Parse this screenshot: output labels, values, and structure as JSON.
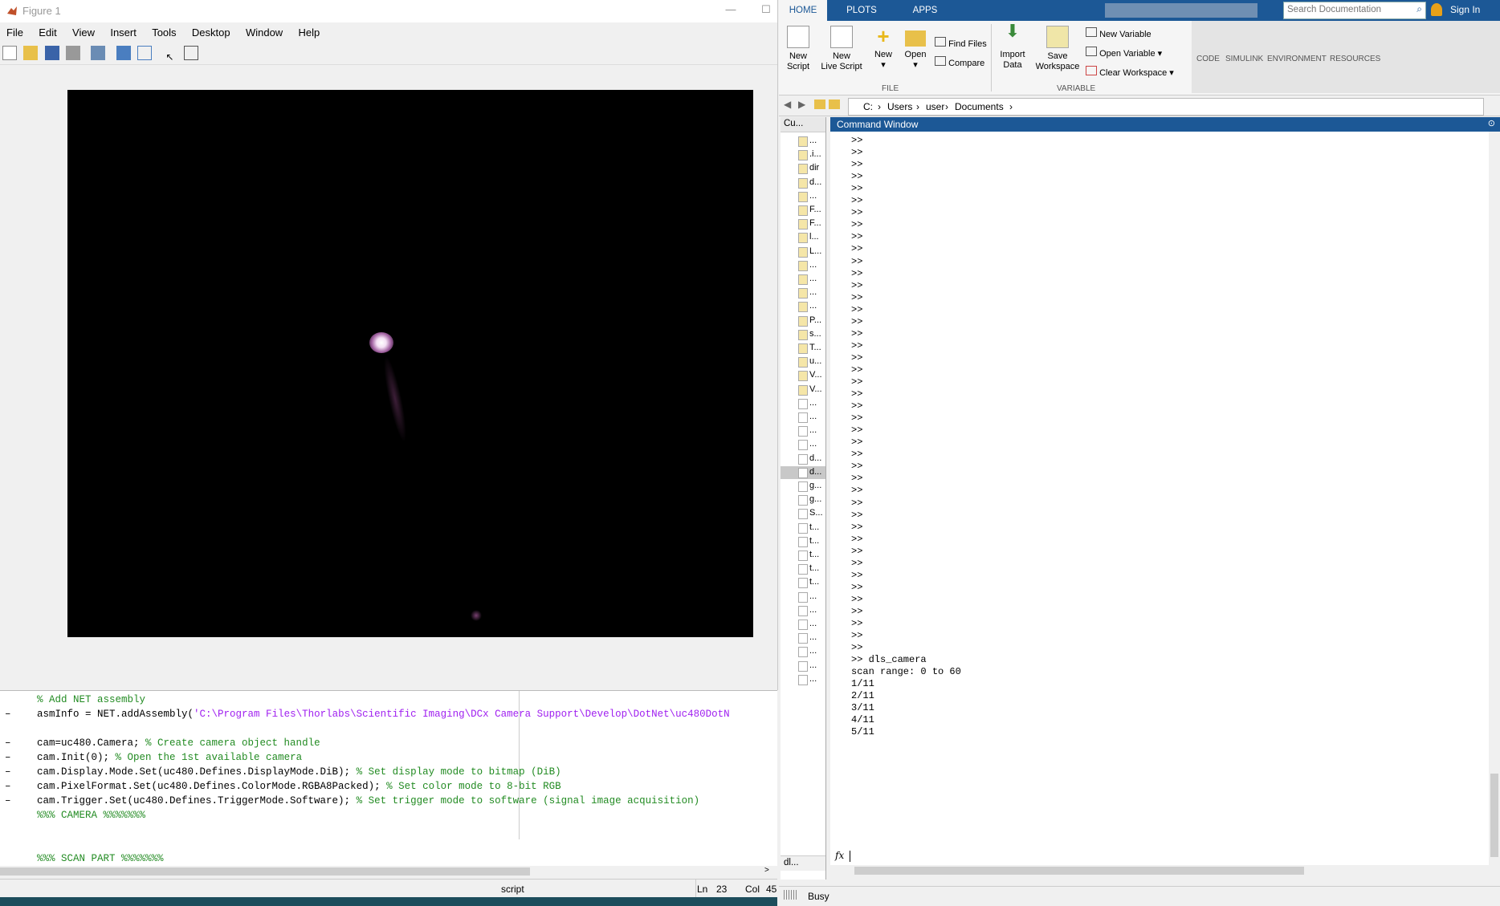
{
  "figure": {
    "title": "Figure 1",
    "menu": [
      "File",
      "Edit",
      "View",
      "Insert",
      "Tools",
      "Desktop",
      "Window",
      "Help"
    ]
  },
  "editor": {
    "lines": [
      {
        "dash": false,
        "parts": [
          {
            "c": "cm",
            "t": "% Add NET assembly"
          }
        ]
      },
      {
        "dash": true,
        "parts": [
          {
            "c": "",
            "t": "asmInfo = NET.addAssembly("
          },
          {
            "c": "st",
            "t": "'C:\\Program Files\\Thorlabs\\Scientific Imaging\\DCx Camera Support\\Develop\\DotNet\\uc480DotN"
          }
        ]
      },
      {
        "dash": false,
        "parts": [
          {
            "c": "",
            "t": ""
          }
        ]
      },
      {
        "dash": true,
        "parts": [
          {
            "c": "",
            "t": "cam=uc480.Camera; "
          },
          {
            "c": "cm",
            "t": "% Create camera object handle"
          }
        ]
      },
      {
        "dash": true,
        "parts": [
          {
            "c": "",
            "t": "cam.Init(0); "
          },
          {
            "c": "cm",
            "t": "% Open the 1st available camera"
          }
        ]
      },
      {
        "dash": true,
        "parts": [
          {
            "c": "",
            "t": "cam.Display.Mode.Set(uc480.Defines.DisplayMode.DiB); "
          },
          {
            "c": "cm",
            "t": "% Set display mode to bitmap (DiB)"
          }
        ]
      },
      {
        "dash": true,
        "parts": [
          {
            "c": "",
            "t": "cam.PixelFormat.Set(uc480.Defines.ColorMode.RGBA8Packed); "
          },
          {
            "c": "cm",
            "t": "% Set color mode to 8-bit RGB"
          }
        ]
      },
      {
        "dash": true,
        "parts": [
          {
            "c": "",
            "t": "cam.Trigger.Set(uc480.Defines.TriggerMode.Software); "
          },
          {
            "c": "cm",
            "t": "% Set trigger mode to software (signal image acquisition)"
          }
        ]
      },
      {
        "dash": false,
        "parts": [
          {
            "c": "cm",
            "t": "%%% CAMERA %%%%%%%"
          }
        ]
      },
      {
        "dash": false,
        "parts": [
          {
            "c": "",
            "t": ""
          }
        ]
      },
      {
        "dash": false,
        "parts": [
          {
            "c": "",
            "t": ""
          }
        ]
      },
      {
        "dash": false,
        "parts": [
          {
            "c": "cm",
            "t": "%%% SCAN PART %%%%%%%"
          }
        ]
      }
    ],
    "status": {
      "type": "script",
      "ln_label": "Ln",
      "ln": "23",
      "col_label": "Col",
      "col": "45"
    }
  },
  "matlab": {
    "tabs": [
      "HOME",
      "PLOTS",
      "APPS"
    ],
    "search_placeholder": "Search Documentation",
    "sign_in": "Sign In",
    "ribbon": {
      "new_script": [
        "New",
        "Script"
      ],
      "new_live_script": [
        "New",
        "Live Script"
      ],
      "new": "New",
      "open": "Open",
      "find_files": "Find Files",
      "compare": "Compare",
      "import_data": [
        "Import",
        "Data"
      ],
      "save_workspace": [
        "Save",
        "Workspace"
      ],
      "new_variable": "New Variable",
      "open_variable": "Open Variable",
      "clear_workspace": "Clear Workspace",
      "code": "CODE",
      "simulink": "SIMULINK",
      "environment": "ENVIRONMENT",
      "resources": "RESOURCES",
      "group_file": "FILE",
      "group_variable": "VARIABLE"
    },
    "path": [
      "C:",
      "Users",
      "user",
      "Documents"
    ],
    "current_folder": {
      "title": "Cu...",
      "items": [
        "...",
        ".i...",
        "dir",
        "d...",
        "...",
        "F...",
        "F...",
        "l...",
        "L...",
        "...",
        "...",
        "...",
        "...",
        "P...",
        "s...",
        "T...",
        "u...",
        "V...",
        "V...",
        "...",
        "...",
        "...",
        "...",
        "d...",
        "d...",
        "g...",
        "g...",
        "S...",
        "t...",
        "t...",
        "t...",
        "t...",
        "t...",
        "...",
        "...",
        "...",
        "...",
        "...",
        "...",
        "..."
      ],
      "footer": "dl..."
    },
    "command_window": {
      "title": "Command Window",
      "prompt": ">>",
      "prompt_count": 43,
      "output": [
        ">> dls_camera",
        "scan range: 0 to 60",
        "1/11",
        "2/11",
        "3/11",
        "4/11",
        "5/11"
      ],
      "fx": "fx"
    },
    "status": "Busy"
  }
}
